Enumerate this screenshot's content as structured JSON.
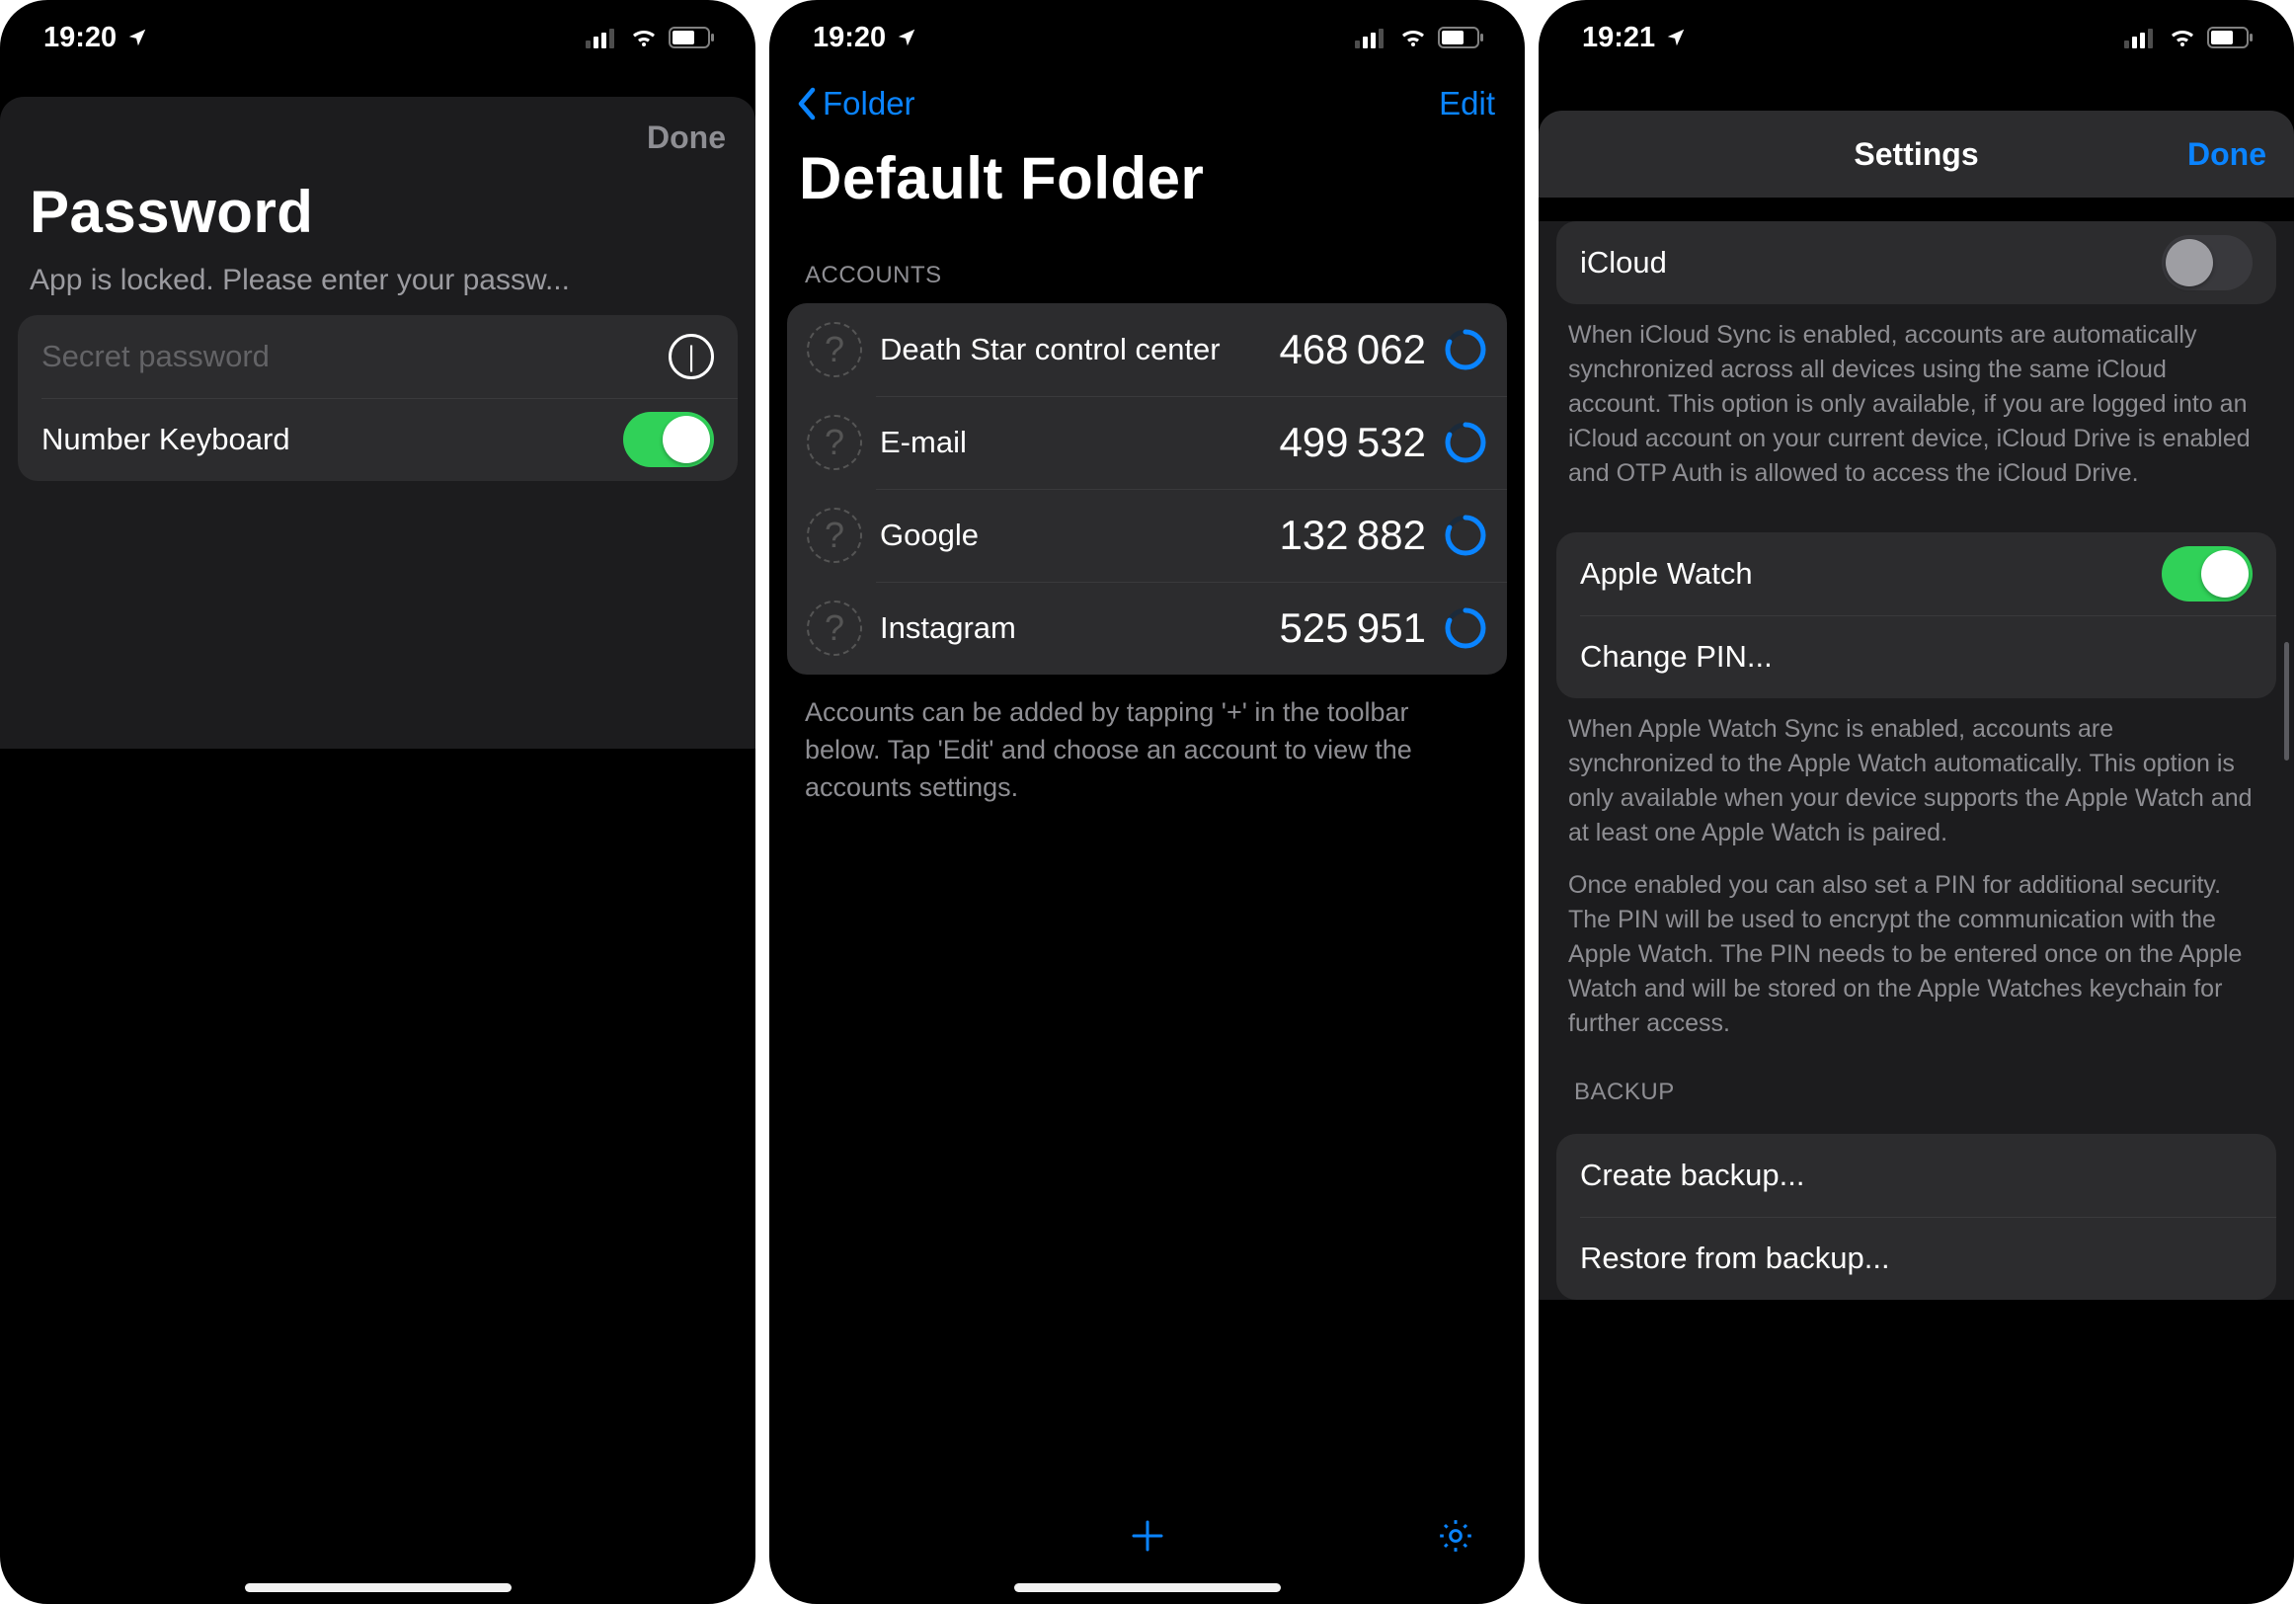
{
  "status": {
    "time1": "19:20",
    "time2": "19:20",
    "time3": "19:21"
  },
  "screen1": {
    "done": "Done",
    "title": "Password",
    "subtitle": "App is locked. Please enter your passw...",
    "placeholder": "Secret password",
    "numberKeyboard": "Number Keyboard"
  },
  "screen2": {
    "back": "Folder",
    "edit": "Edit",
    "title": "Default Folder",
    "sectionHeader": "ACCOUNTS",
    "accounts": [
      {
        "name": "Death Star control center",
        "code": "468 062"
      },
      {
        "name": "E-mail",
        "code": "499 532"
      },
      {
        "name": "Google",
        "code": "132 882"
      },
      {
        "name": "Instagram",
        "code": "525 951"
      }
    ],
    "footer": "Accounts can be added by tapping '+' in the toolbar below. Tap 'Edit' and choose an account to view the accounts settings."
  },
  "screen3": {
    "title": "Settings",
    "done": "Done",
    "icloud": "iCloud",
    "icloudFooter": "When iCloud Sync is enabled, accounts are automatically synchronized across all devices using the same iCloud account. This option is only available, if you are logged into an iCloud account on your current device, iCloud Drive is enabled and OTP Auth is allowed to access the iCloud Drive.",
    "appleWatch": "Apple Watch",
    "changePin": "Change PIN...",
    "watchFooter1": "When Apple Watch Sync is enabled, accounts are synchronized to the Apple Watch automatically. This option is only available when your device supports the Apple Watch and at least one Apple Watch is paired.",
    "watchFooter2": "Once enabled you can also set a PIN for additional security. The PIN will be used to encrypt the communication with the Apple Watch. The PIN needs to be entered once on the Apple Watch and will be stored on the Apple Watches keychain for further access.",
    "backupHeader": "BACKUP",
    "createBackup": "Create backup...",
    "restoreBackup": "Restore from backup..."
  }
}
